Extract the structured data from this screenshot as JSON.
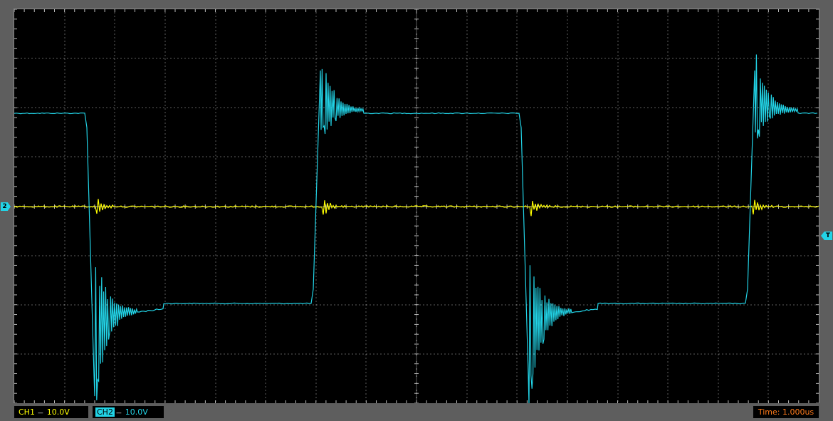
{
  "channels": {
    "ch1": {
      "name": "CH1",
      "coupling": "---",
      "scale": "10.0V",
      "color": "#ffff00"
    },
    "ch2": {
      "name": "CH2",
      "coupling": "---",
      "scale": "10.0V",
      "color": "#22d3e6"
    }
  },
  "markers": {
    "ch2_ground": "2",
    "trigger": "T"
  },
  "timebase": "Time: 1.000us",
  "colors": {
    "screen_background": "#000000",
    "grid": "#bbbbbb",
    "frame": "#5e5e5e",
    "time_text": "#ff7a1a"
  },
  "grid": {
    "horizontal_divisions": 16,
    "vertical_divisions": 8
  }
}
